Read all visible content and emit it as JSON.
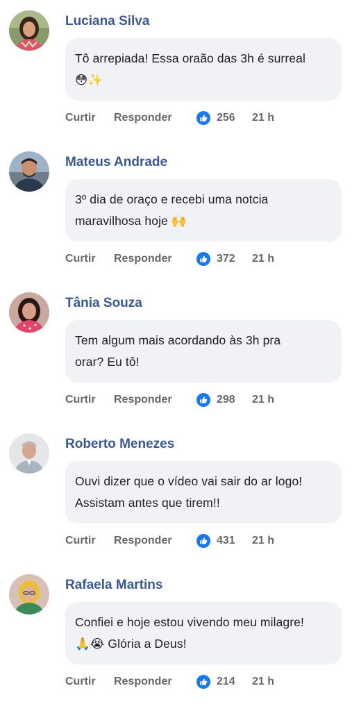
{
  "actions": {
    "like_label": "Curtir",
    "reply_label": "Responder"
  },
  "comments": [
    {
      "author": "Luciana Silva",
      "text_line1": "Tô arrepiada! Essa oraão das 3h é surreal",
      "text_line2": "😳✨",
      "reactions": "256",
      "time": "21 h"
    },
    {
      "author": "Mateus Andrade",
      "text_line1": "3º dia de oraço e recebi uma notcia",
      "text_line2": "maravilhosa hoje 🙌",
      "reactions": "372",
      "time": "21 h"
    },
    {
      "author": "Tânia Souza",
      "text_line1": "Tem algum mais acordando às 3h pra",
      "text_line2": "orar? Eu tô!",
      "reactions": "298",
      "time": "21 h"
    },
    {
      "author": "Roberto Menezes",
      "text_line1": "Ouvi dizer que o vídeo vai sair do ar logo!",
      "text_line2": "Assistam antes que tirem!!",
      "reactions": "431",
      "time": "21 h"
    },
    {
      "author": "Rafaela Martins",
      "text_line1": "Confiei e hoje estou vivendo meu milagre!",
      "text_line2": "🙏😭 Glória a Deus!",
      "reactions": "214",
      "time": "21 h"
    }
  ],
  "colors": {
    "author_link": "#385898",
    "bubble_bg": "#f0f2f5",
    "text": "#1c1e21",
    "action_text": "#65676b",
    "like_blue": "#1877f2"
  }
}
